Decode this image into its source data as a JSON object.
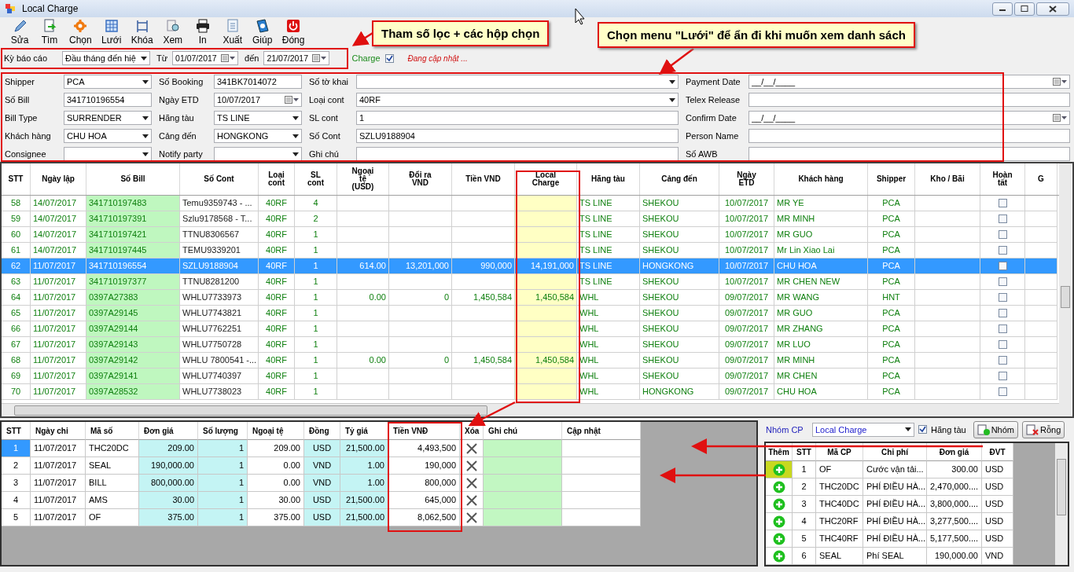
{
  "window": {
    "title": "Local Charge"
  },
  "toolbar": [
    {
      "label": "Sửa"
    },
    {
      "label": "Tìm"
    },
    {
      "label": "Chọn"
    },
    {
      "label": "Lưới"
    },
    {
      "label": "Khóa"
    },
    {
      "label": "Xem"
    },
    {
      "label": "In"
    },
    {
      "label": "Xuất"
    },
    {
      "label": "Giúp"
    },
    {
      "label": "Đóng"
    }
  ],
  "filter": {
    "period_label": "Kỳ báo cáo",
    "period_value": "Đầu tháng đến hiệ",
    "from_label": "Từ",
    "from_value": "01/07/2017",
    "to_label": "đến",
    "to_value": "21/07/2017",
    "charge_label": "Charge",
    "charge_checked": true,
    "status": "Đang cập nhật ..."
  },
  "form": {
    "rows": [
      [
        {
          "label": "Shipper",
          "kind": "combo",
          "value": "PCA"
        },
        {
          "label": "Số Booking",
          "kind": "text",
          "value": "341BK7014072"
        },
        {
          "label": "Số tờ khai",
          "kind": "combo"
        },
        {
          "label": "Payment Date",
          "kind": "date",
          "value": "__/__/____"
        }
      ],
      [
        {
          "label": "Số Bill",
          "kind": "text",
          "value": "341710196554"
        },
        {
          "label": "Ngày ETD",
          "kind": "date",
          "value": "10/07/2017"
        },
        {
          "label": "Loại cont",
          "kind": "combo",
          "value": "40RF"
        },
        {
          "label": "Telex Release",
          "kind": "text"
        }
      ],
      [
        {
          "label": "Bill Type",
          "kind": "combo",
          "value": "SURRENDER"
        },
        {
          "label": "Hãng tàu",
          "kind": "combo",
          "value": "TS LINE"
        },
        {
          "label": "SL cont",
          "kind": "text",
          "value": "1"
        },
        {
          "label": "Confirm Date",
          "kind": "date",
          "value": "__/__/____"
        }
      ],
      [
        {
          "label": "Khách hàng",
          "kind": "combo",
          "value": "CHU HOA"
        },
        {
          "label": "Cảng đến",
          "kind": "combo",
          "value": "HONGKONG"
        },
        {
          "label": "Số Cont",
          "kind": "text",
          "value": "SZLU9188904"
        },
        {
          "label": "Person Name",
          "kind": "text"
        }
      ],
      [
        {
          "label": "Consignee",
          "kind": "combo"
        },
        {
          "label": "Notify party",
          "kind": "combo"
        },
        {
          "label": "Ghi chú",
          "kind": "text"
        },
        {
          "label": "Số AWB",
          "kind": "text"
        }
      ]
    ]
  },
  "main_grid": {
    "columns": [
      "STT",
      "Ngày lập",
      "Số Bill",
      "Số Cont",
      "Loại\ncont",
      "SL\ncont",
      "Ngoại\ntệ\n(USD)",
      "Đổi ra\nVND",
      "Tiền VND",
      "Local\nCharge",
      "Hãng tàu",
      "Cảng đến",
      "Ngày\nETD",
      "Khách hàng",
      "Shipper",
      "Kho / Bãi",
      "Hoàn\ntất",
      "G"
    ],
    "rows": [
      {
        "selected": false,
        "done": false,
        "stt": "58",
        "date": "14/07/2017",
        "bill": "341710197483",
        "cont": "Temu9359743 - ...",
        "type": "40RF",
        "sl": "4",
        "line": "TS LINE",
        "port": "SHEKOU",
        "etd": "10/07/2017",
        "cust": "MR YE",
        "shipper": "PCA"
      },
      {
        "selected": false,
        "done": false,
        "stt": "59",
        "date": "14/07/2017",
        "bill": "341710197391",
        "cont": "Szlu9178568 - T...",
        "type": "40RF",
        "sl": "2",
        "line": "TS LINE",
        "port": "SHEKOU",
        "etd": "10/07/2017",
        "cust": "MR MINH",
        "shipper": "PCA"
      },
      {
        "selected": false,
        "done": false,
        "stt": "60",
        "date": "14/07/2017",
        "bill": "341710197421",
        "cont": "TTNU8306567",
        "type": "40RF",
        "sl": "1",
        "line": "TS LINE",
        "port": "SHEKOU",
        "etd": "10/07/2017",
        "cust": "MR GUO",
        "shipper": "PCA"
      },
      {
        "selected": false,
        "done": false,
        "stt": "61",
        "date": "14/07/2017",
        "bill": "341710197445",
        "cont": "TEMU9339201",
        "type": "40RF",
        "sl": "1",
        "line": "TS LINE",
        "port": "SHEKOU",
        "etd": "10/07/2017",
        "cust": "Mr Lin Xiao Lai",
        "shipper": "PCA"
      },
      {
        "selected": true,
        "done": false,
        "stt": "62",
        "date": "11/07/2017",
        "bill": "341710196554",
        "cont": "SZLU9188904",
        "type": "40RF",
        "sl": "1",
        "fx": "614.00",
        "conv": "13,201,000",
        "vnd": "990,000",
        "local": "14,191,000",
        "line": "TS LINE",
        "port": "HONGKONG",
        "etd": "10/07/2017",
        "cust": "CHU HOA",
        "shipper": "PCA"
      },
      {
        "selected": false,
        "done": false,
        "stt": "63",
        "date": "11/07/2017",
        "bill": "341710197377",
        "cont": "TTNU8281200",
        "type": "40RF",
        "sl": "1",
        "line": "TS LINE",
        "port": "SHEKOU",
        "etd": "10/07/2017",
        "cust": "MR CHEN NEW",
        "shipper": "PCA"
      },
      {
        "selected": false,
        "done": false,
        "stt": "64",
        "date": "11/07/2017",
        "bill": "0397A27383",
        "cont": "WHLU7733973",
        "type": "40RF",
        "sl": "1",
        "fx": "0.00",
        "conv": "0",
        "vnd": "1,450,584",
        "local": "1,450,584",
        "line": "WHL",
        "port": "SHEKOU",
        "etd": "09/07/2017",
        "cust": "MR WANG",
        "shipper": "HNT"
      },
      {
        "selected": false,
        "done": false,
        "stt": "65",
        "date": "11/07/2017",
        "bill": "0397A29145",
        "cont": "WHLU7743821",
        "type": "40RF",
        "sl": "1",
        "line": "WHL",
        "port": "SHEKOU",
        "etd": "09/07/2017",
        "cust": "MR GUO",
        "shipper": "PCA"
      },
      {
        "selected": false,
        "done": false,
        "stt": "66",
        "date": "11/07/2017",
        "bill": "0397A29144",
        "cont": "WHLU7762251",
        "type": "40RF",
        "sl": "1",
        "line": "WHL",
        "port": "SHEKOU",
        "etd": "09/07/2017",
        "cust": "MR ZHANG",
        "shipper": "PCA"
      },
      {
        "selected": false,
        "done": false,
        "stt": "67",
        "date": "11/07/2017",
        "bill": "0397A29143",
        "cont": "WHLU7750728",
        "type": "40RF",
        "sl": "1",
        "line": "WHL",
        "port": "SHEKOU",
        "etd": "09/07/2017",
        "cust": "MR LUO",
        "shipper": "PCA"
      },
      {
        "selected": false,
        "done": false,
        "stt": "68",
        "date": "11/07/2017",
        "bill": "0397A29142",
        "cont": "WHLU 7800541 -...",
        "type": "40RF",
        "sl": "1",
        "fx": "0.00",
        "conv": "0",
        "vnd": "1,450,584",
        "local": "1,450,584",
        "line": "WHL",
        "port": "SHEKOU",
        "etd": "09/07/2017",
        "cust": "MR MINH",
        "shipper": "PCA"
      },
      {
        "selected": false,
        "done": false,
        "stt": "69",
        "date": "11/07/2017",
        "bill": "0397A29141",
        "cont": "WHLU7740397",
        "type": "40RF",
        "sl": "1",
        "line": "WHL",
        "port": "SHEKOU",
        "etd": "09/07/2017",
        "cust": "MR CHEN",
        "shipper": "PCA"
      },
      {
        "selected": false,
        "done": false,
        "stt": "70",
        "date": "11/07/2017",
        "bill": "0397A28532",
        "cont": "WHLU7738023",
        "type": "40RF",
        "sl": "1",
        "line": "WHL",
        "port": "HONGKONG",
        "etd": "09/07/2017",
        "cust": "CHU HOA",
        "shipper": "PCA"
      }
    ]
  },
  "detail_grid": {
    "columns": [
      "STT",
      "Ngày chi",
      "Mã số",
      "Đơn giá",
      "Số lượng",
      "Ngoại tệ",
      "Đồng",
      "Tỷ giá",
      "Tiền VNĐ",
      "Xóa",
      "Ghi chú",
      "Cập nhật"
    ],
    "rows": [
      {
        "selected": true,
        "cells": [
          "1",
          "11/07/2017",
          "THC20DC",
          "209.00",
          "1",
          "209.00",
          "USD",
          "21,500.00",
          "4,493,500"
        ]
      },
      {
        "selected": false,
        "cells": [
          "2",
          "11/07/2017",
          "SEAL",
          "190,000.00",
          "1",
          "0.00",
          "VND",
          "1.00",
          "190,000"
        ]
      },
      {
        "selected": false,
        "cells": [
          "3",
          "11/07/2017",
          "BILL",
          "800,000.00",
          "1",
          "0.00",
          "VND",
          "1.00",
          "800,000"
        ]
      },
      {
        "selected": false,
        "cells": [
          "4",
          "11/07/2017",
          "AMS",
          "30.00",
          "1",
          "30.00",
          "USD",
          "21,500.00",
          "645,000"
        ]
      },
      {
        "selected": false,
        "cells": [
          "5",
          "11/07/2017",
          "OF",
          "375.00",
          "1",
          "375.00",
          "USD",
          "21,500.00",
          "8,062,500"
        ]
      }
    ]
  },
  "charge_panel": {
    "group_label": "Nhóm CP",
    "group_value": "Local Charge",
    "carrier_label": "Hãng tàu",
    "carrier_checked": true,
    "group_button": "Nhóm",
    "clear_button": "Rỗng",
    "columns": [
      "Thêm",
      "STT",
      "Mã CP",
      "Chi phí",
      "Đơn giá",
      "ĐVT"
    ],
    "rows": [
      {
        "selected": true,
        "cells": [
          "",
          "1",
          "OF",
          "Cước vận tải...",
          "300.00",
          "USD"
        ]
      },
      {
        "selected": false,
        "cells": [
          "",
          "2",
          "THC20DC",
          "PHÍ ĐIỀU HÀ...",
          "2,470,000....",
          "USD"
        ]
      },
      {
        "selected": false,
        "cells": [
          "",
          "3",
          "THC40DC",
          "PHÍ ĐIỀU HÀ...",
          "3,800,000....",
          "USD"
        ]
      },
      {
        "selected": false,
        "cells": [
          "",
          "4",
          "THC20RF",
          "PHÍ ĐIỀU HÀ...",
          "3,277,500....",
          "USD"
        ]
      },
      {
        "selected": false,
        "cells": [
          "",
          "5",
          "THC40RF",
          "PHÍ ĐIỀU HÀ...",
          "5,177,500....",
          "USD"
        ]
      },
      {
        "selected": false,
        "cells": [
          "",
          "6",
          "SEAL",
          "Phí SEAL",
          "190,000.00",
          "VND"
        ]
      }
    ]
  },
  "callouts": [
    {
      "text": "Tham số lọc + các hộp chọn"
    },
    {
      "text": "Chọn menu \"Lưới\" để ẩn đi khi muốn xem danh sách"
    }
  ]
}
